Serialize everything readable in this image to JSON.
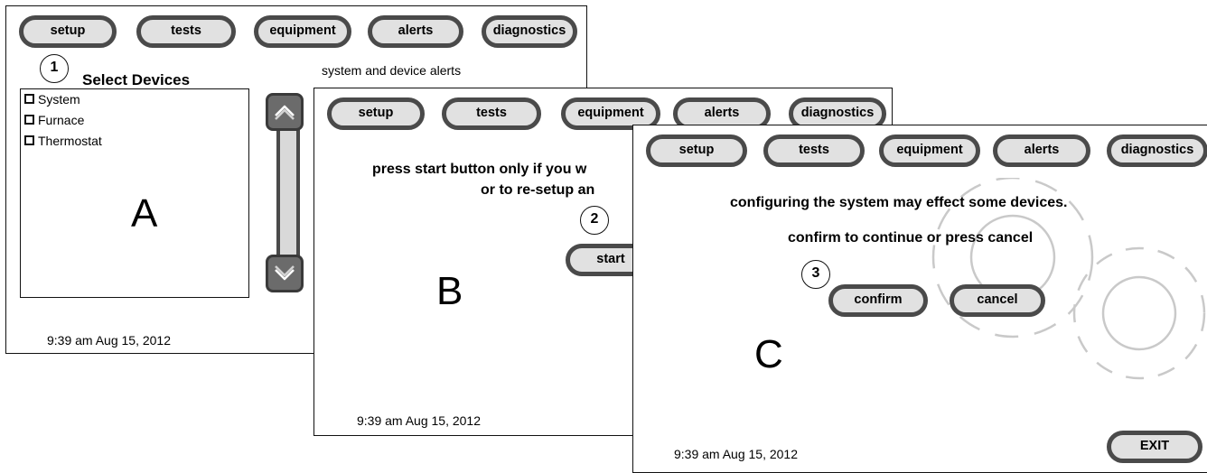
{
  "tabs": [
    "setup",
    "tests",
    "equipment",
    "alerts",
    "diagnostics"
  ],
  "screen_a": {
    "step": "1",
    "title": "Select Devices",
    "subtitle": "system and device alerts",
    "devices": [
      "System",
      "Furnace",
      "Thermostat"
    ],
    "letter": "A",
    "datetime": "9:39 am Aug 15, 2012"
  },
  "screen_b": {
    "message_line1": "press start button only if you w",
    "message_line2": "or to re-setup an",
    "step": "2",
    "start_label": "start",
    "letter": "B",
    "datetime": "9:39 am Aug 15, 2012"
  },
  "screen_c": {
    "message_line1": "configuring the system may effect some devices.",
    "message_line2": "confirm to continue or press cancel",
    "step": "3",
    "confirm_label": "confirm",
    "cancel_label": "cancel",
    "letter": "C",
    "exit_label": "EXIT",
    "datetime": "9:39 am Aug 15, 2012"
  },
  "icons": {
    "scroll_up": "chevron-up-icon",
    "scroll_down": "chevron-down-icon",
    "background": "gear-icon"
  }
}
